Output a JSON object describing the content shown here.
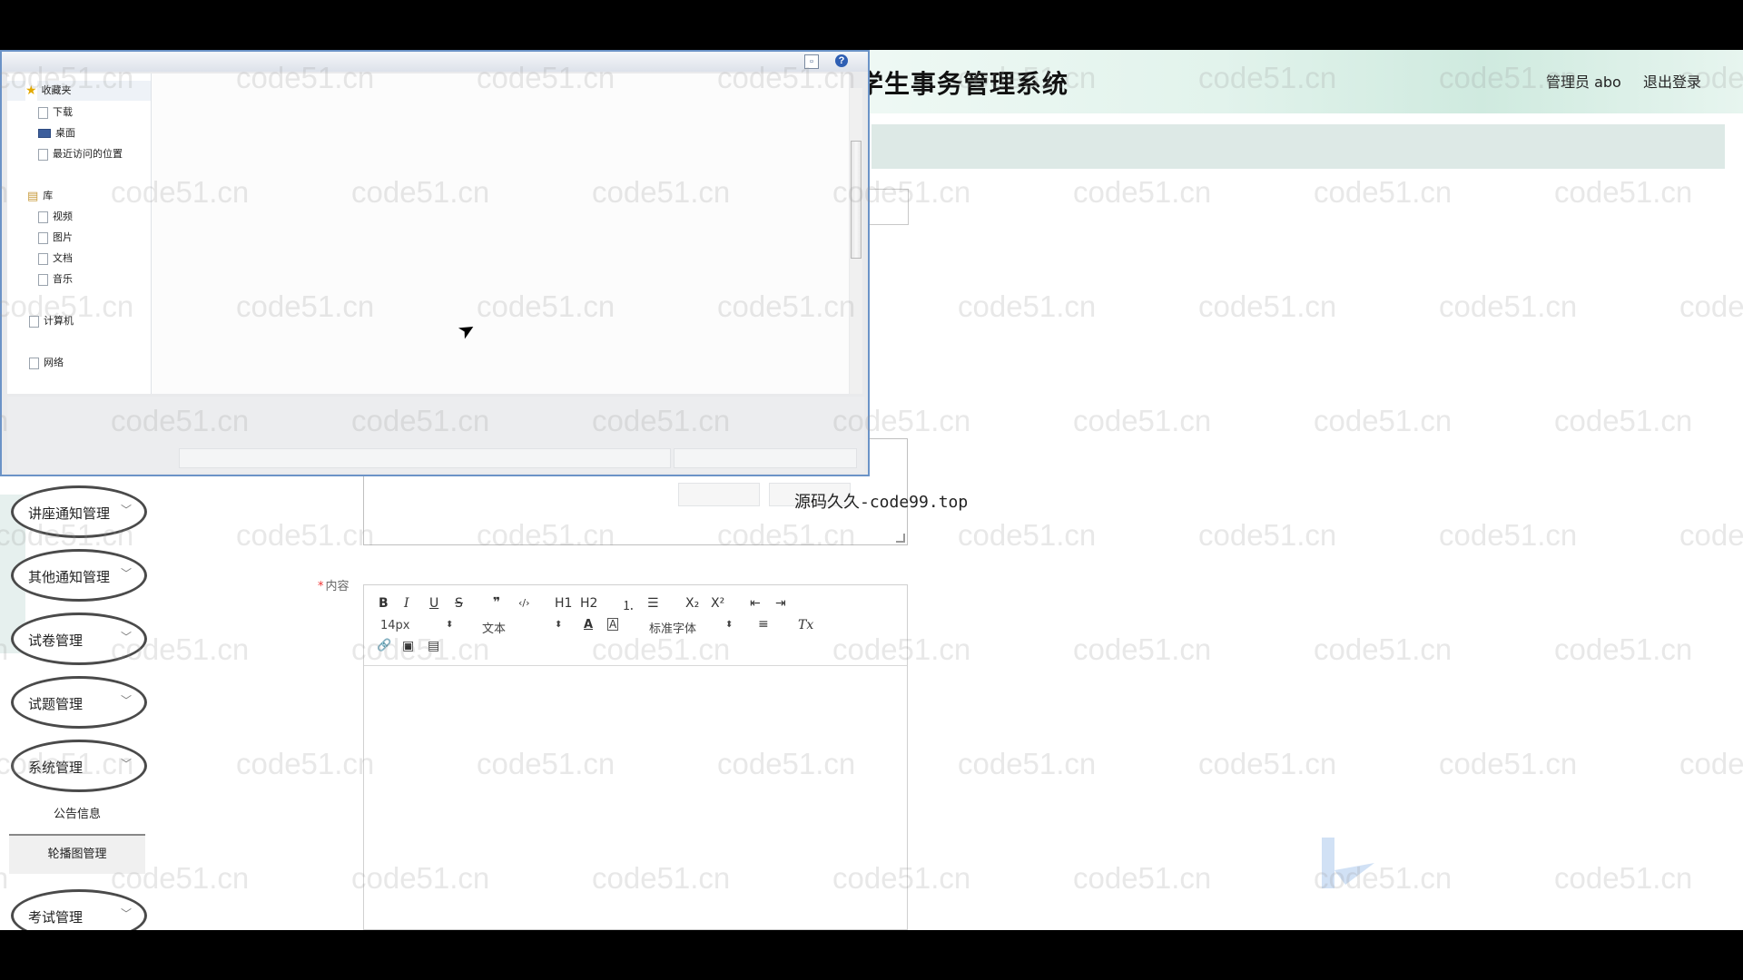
{
  "header": {
    "title": "学生事务管理系统",
    "user": "管理员 abo",
    "logout": "退出登录"
  },
  "watermark": "code51.cn",
  "source_text": "源码久久-code99.top",
  "sidebar": {
    "menus": [
      {
        "label": "讲座通知管理"
      },
      {
        "label": "其他通知管理"
      },
      {
        "label": "试卷管理"
      },
      {
        "label": "试题管理"
      },
      {
        "label": "系统管理"
      }
    ],
    "sub_items": [
      {
        "label": "公告信息"
      },
      {
        "label": "轮播图管理"
      }
    ],
    "last_menu": {
      "label": "考试管理"
    }
  },
  "form": {
    "content_label": "内容",
    "required_mark": "*"
  },
  "editor": {
    "font_size": "14px",
    "block_type": "文本",
    "font_family": "标准字体",
    "buttons": {
      "bold": "B",
      "italic": "I",
      "underline": "U",
      "strike": "S",
      "quote": "❞",
      "code": "‹/›",
      "h1": "H1",
      "h2": "H2",
      "ol": "⒈",
      "ul": "☰",
      "sub": "X₂",
      "sup": "X²",
      "indent_dec": "⇤",
      "indent_inc": "⇥",
      "color": "A",
      "bg_color": "A",
      "align": "≡",
      "clear": "Tx",
      "link": "🔗",
      "image": "▣",
      "video": "▤"
    }
  },
  "dialog": {
    "nav": {
      "favorites": "收藏夹",
      "download": "下载",
      "desktop": "桌面",
      "recent": "最近访问的位置",
      "library": "库",
      "video": "视频",
      "pictures": "图片",
      "documents": "文档",
      "music": "音乐",
      "computer": "计算机",
      "network": "网络"
    },
    "help_icon": "?",
    "view_icon": "▫"
  }
}
